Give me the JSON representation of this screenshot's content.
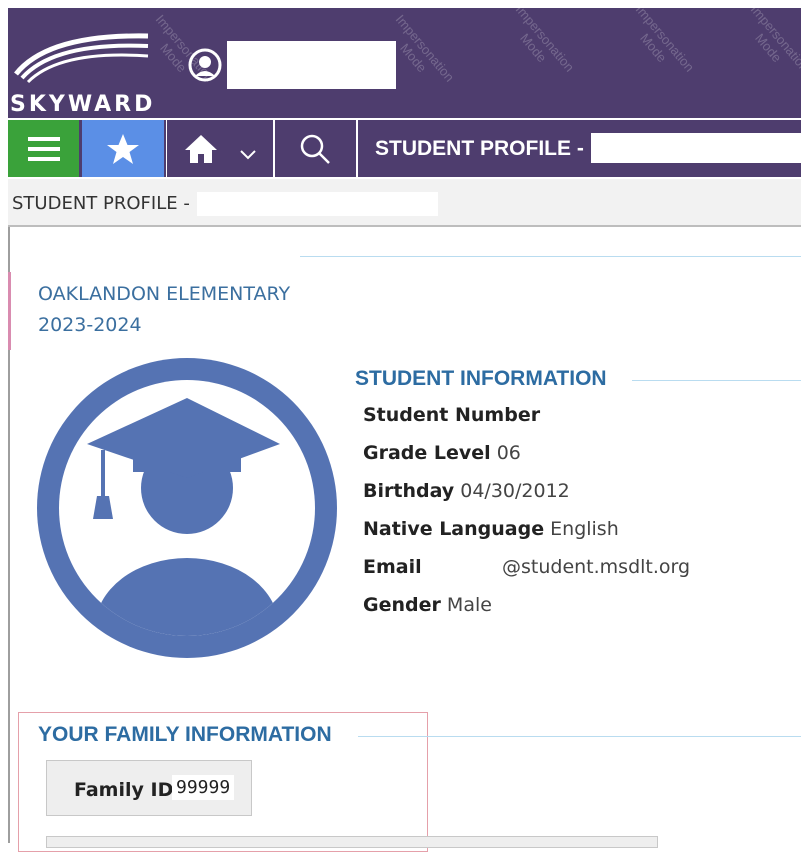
{
  "app": {
    "brand": "SKYWARD",
    "watermark_text": [
      "Impersonation",
      "Mode"
    ],
    "colors": {
      "header": "#4e3d6e",
      "menu_button": "#3aa23a",
      "favorites_button": "#5b8fe6",
      "accent_blue": "#2d6ca2",
      "avatar": "#5573b3"
    }
  },
  "nav": {
    "menu_icon": "hamburger-icon",
    "favorites_icon": "star-icon",
    "home_icon": "home-icon",
    "home_dropdown_icon": "chevron-down-icon",
    "search_icon": "search-icon",
    "page_title": "STUDENT PROFILE -"
  },
  "breadcrumb": "STUDENT PROFILE -",
  "school": {
    "name": "OAKLANDON ELEMENTARY",
    "year": "2023-2024"
  },
  "student_info": {
    "title": "STUDENT INFORMATION",
    "rows": [
      {
        "label": "Student Number",
        "value": ""
      },
      {
        "label": "Grade Level",
        "value": "06"
      },
      {
        "label": "Birthday",
        "value": "04/30/2012"
      },
      {
        "label": "Native Language",
        "value": "English"
      },
      {
        "label": "Email",
        "value": "@student.msdlt.org"
      },
      {
        "label": "Gender",
        "value": "Male"
      }
    ]
  },
  "family_info": {
    "title": "YOUR FAMILY INFORMATION",
    "family_id_label": "Family ID",
    "family_id_value": "99999"
  }
}
